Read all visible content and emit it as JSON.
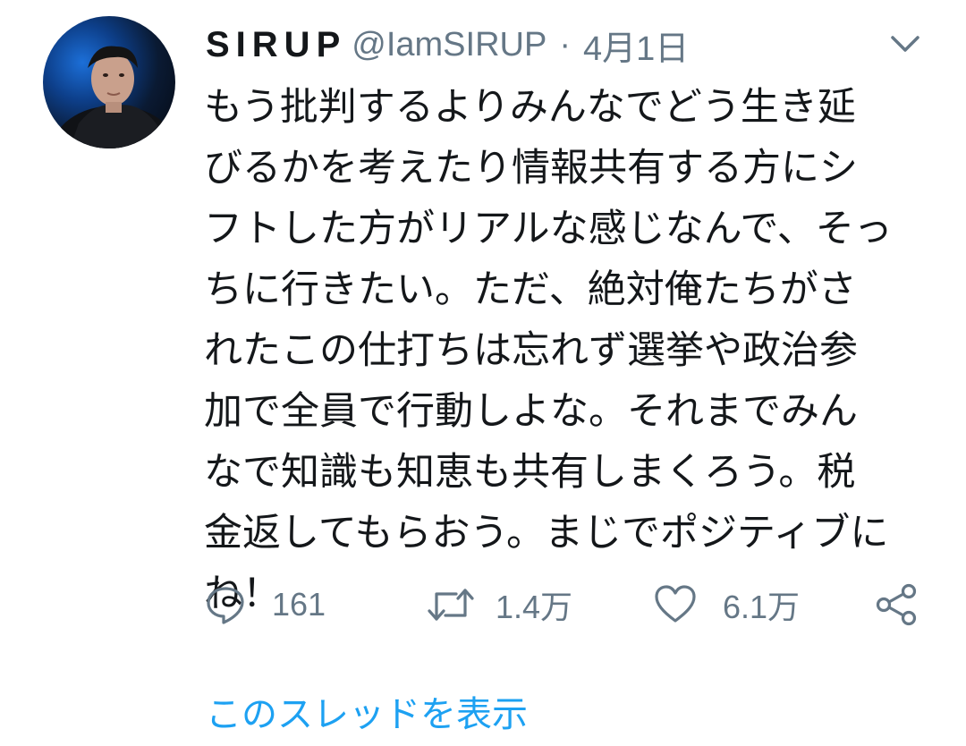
{
  "tweet": {
    "display_name": "SIRUP",
    "handle": "@IamSIRUP",
    "separator": "·",
    "date": "4月1日",
    "text": "もう批判するよりみんなでどう生き延\nびるかを考えたり情報共有する方にシ\nフトした方がリアルな感じなんで、そっ\nちに行きたい。ただ、絶対俺たちがさ\nれたこの仕打ちは忘れず選挙や政治参\n加で全員で行動しよな。それまでみん\nなで知識も知恵も共有しまくろう。税\n金返してもらおう。まじでポジティブに\nね！"
  },
  "actions": {
    "reply": {
      "icon": "reply-icon",
      "count": "161"
    },
    "retweet": {
      "icon": "retweet-icon",
      "count": "1.4万"
    },
    "like": {
      "icon": "heart-icon",
      "count": "6.1万"
    },
    "share": {
      "icon": "share-icon"
    }
  },
  "thread_link": "このスレッドを表示",
  "colors": {
    "text": "#14171a",
    "secondary": "#657786",
    "link": "#1da1f2",
    "background": "#ffffff"
  }
}
